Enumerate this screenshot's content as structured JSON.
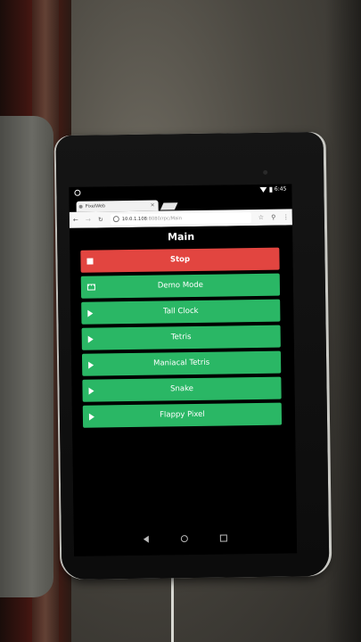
{
  "status_bar": {
    "time": "6:45"
  },
  "browser": {
    "tab_title": "PixelWeb",
    "tab_close": "×",
    "url_host": "10.0.1.108",
    "url_path": ":8080/rpc/Main",
    "back_glyph": "←",
    "forward_glyph": "→",
    "reload_glyph": "↻",
    "star_glyph": "☆",
    "mic_glyph": "⚲",
    "menu_glyph": "⋮"
  },
  "page": {
    "title": "Main",
    "buttons": [
      {
        "label": "Stop",
        "icon": "stop-icon",
        "color": "#e24540"
      },
      {
        "label": "Demo Mode",
        "icon": "film-icon",
        "color": "#2ab765"
      },
      {
        "label": "Tall Clock",
        "icon": "play-icon",
        "color": "#2ab765"
      },
      {
        "label": "Tetris",
        "icon": "play-icon",
        "color": "#2ab765"
      },
      {
        "label": "Maniacal Tetris",
        "icon": "play-icon",
        "color": "#2ab765"
      },
      {
        "label": "Snake",
        "icon": "play-icon",
        "color": "#2ab765"
      },
      {
        "label": "Flappy Pixel",
        "icon": "play-icon",
        "color": "#2ab765"
      }
    ]
  },
  "nav": {
    "back": "back-icon",
    "home": "home-icon",
    "recents": "recents-icon"
  }
}
